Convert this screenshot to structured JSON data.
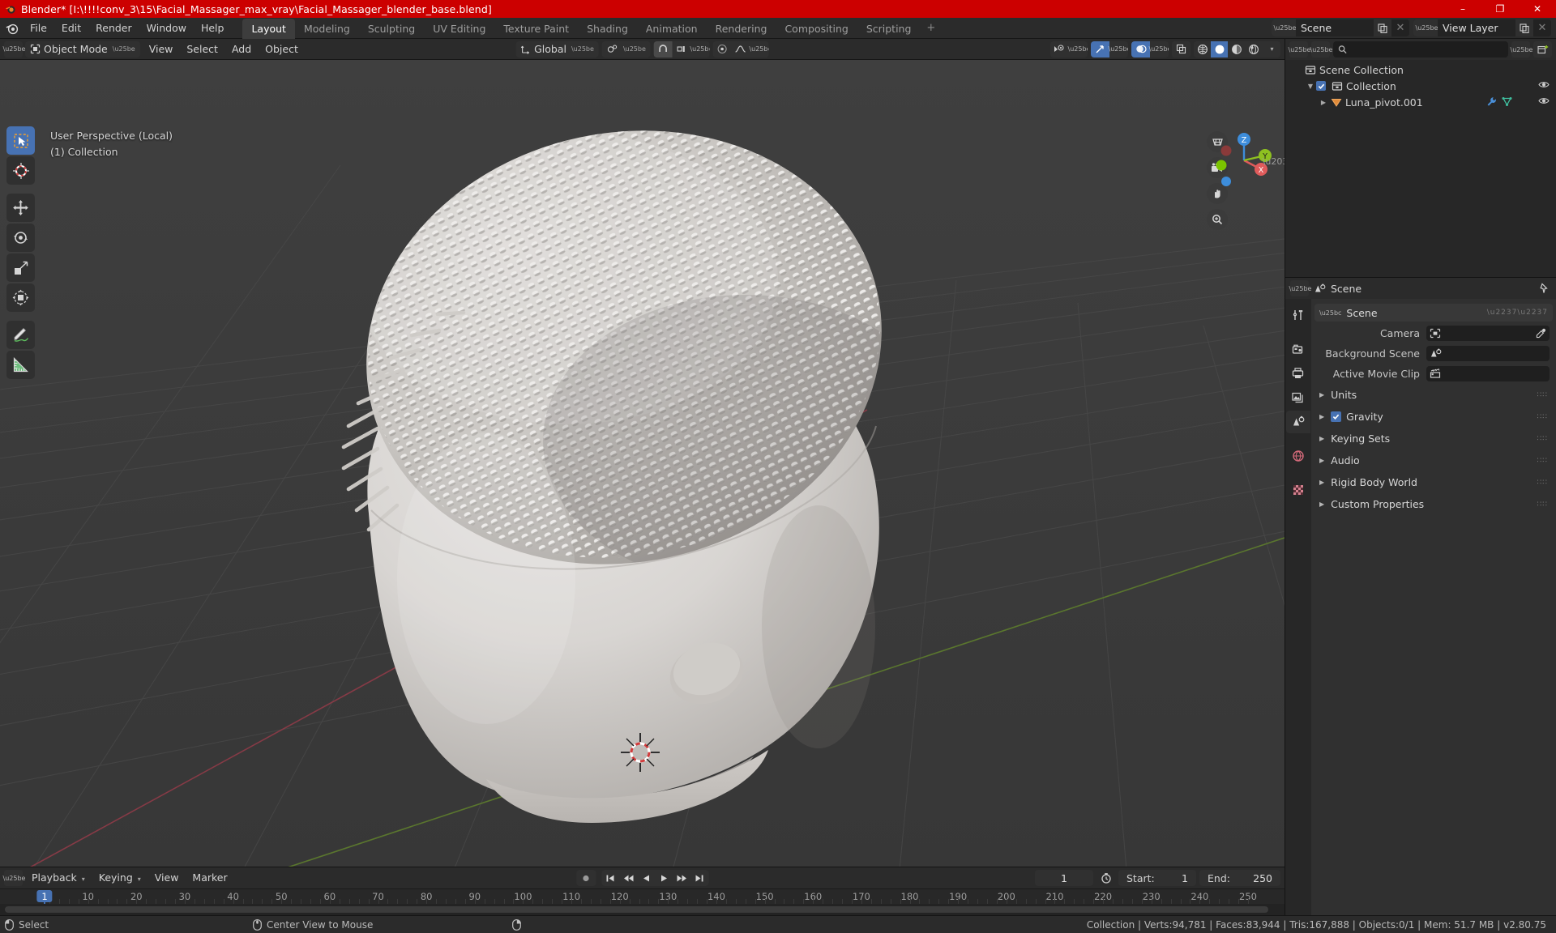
{
  "window": {
    "title": "Blender* [I:\\!!!!conv_3\\15\\Facial_Massager_max_vray\\Facial_Massager_blender_base.blend]",
    "icon": "blender-logo-icon",
    "minimize": "–",
    "maximize": "❐",
    "close": "✕"
  },
  "topbar": {
    "menus": [
      "File",
      "Edit",
      "Render",
      "Window",
      "Help"
    ],
    "workspaces": [
      {
        "label": "Layout",
        "active": true
      },
      {
        "label": "Modeling",
        "active": false
      },
      {
        "label": "Sculpting",
        "active": false
      },
      {
        "label": "UV Editing",
        "active": false
      },
      {
        "label": "Texture Paint",
        "active": false
      },
      {
        "label": "Shading",
        "active": false
      },
      {
        "label": "Animation",
        "active": false
      },
      {
        "label": "Rendering",
        "active": false
      },
      {
        "label": "Compositing",
        "active": false
      },
      {
        "label": "Scripting",
        "active": false
      }
    ],
    "add_workspace": "+",
    "scene": {
      "name": "Scene",
      "icon": "scene-icon",
      "new_label": "new-scene-icon",
      "remove_label": "✕"
    },
    "view_layer": {
      "name": "View Layer",
      "icon": "view-layer-icon",
      "new_label": "new-layer-icon",
      "remove_label": "✕"
    }
  },
  "viewport": {
    "header": {
      "editor_type": "editor-type-3dview-icon",
      "mode": "Object Mode",
      "menus": [
        "View",
        "Select",
        "Add",
        "Object"
      ],
      "transform_orientation": "Global",
      "snap_icon": "magnet-icon",
      "snap_target": "snap-increment-icon",
      "proportional_icon": "proportional-edit-icon",
      "falloff_icon": "smooth-falloff-icon",
      "pivot_icon": "pivot-point-icon",
      "visibility_icon": "object-visibility-icon",
      "gizmo_icon": "gizmo-icon",
      "overlay_icon": "overlays-icon",
      "xray_icon": "xray-icon",
      "shading_modes": [
        "wireframe",
        "solid",
        "material-preview",
        "rendered"
      ],
      "shading_active": "solid"
    },
    "overlay_text": [
      "User Perspective (Local)",
      "(1) Collection"
    ],
    "tools": [
      {
        "name": "select-box-tool",
        "active": true
      },
      {
        "name": "cursor-tool",
        "active": false
      },
      {
        "name": "move-tool",
        "active": false
      },
      {
        "name": "rotate-tool",
        "active": false
      },
      {
        "name": "scale-tool",
        "active": false
      },
      {
        "name": "transform-tool",
        "active": false
      },
      {
        "name": "annotate-tool",
        "active": false
      },
      {
        "name": "measure-tool",
        "active": false
      }
    ],
    "nav_buttons": [
      "toggle-orthographic-icon",
      "camera-view-icon",
      "move-view-icon",
      "zoom-view-icon"
    ],
    "gizmo_axes": [
      {
        "label": "Z",
        "color": "#3d8ddb"
      },
      {
        "label": "Y",
        "color": "#8ec020"
      },
      {
        "label": "X",
        "color": "#e05b5b"
      }
    ],
    "object_color": "#d5d2cf",
    "background_color": "#3b3b3b"
  },
  "timeline": {
    "editor_icon": "editor-type-timeline-icon",
    "menus": [
      "Playback",
      "Keying",
      "View",
      "Marker"
    ],
    "record_icon": "auto-keying-icon",
    "controls": [
      "jump-to-start",
      "jump-prev-keyframe",
      "play-reverse",
      "play",
      "jump-next-keyframe",
      "jump-to-end"
    ],
    "current_frame": "1",
    "timer_icon": "frame-range-icon",
    "start_label": "Start:",
    "start_value": "1",
    "end_label": "End:",
    "end_value": "250",
    "ticks": [
      "10",
      "20",
      "30",
      "40",
      "50",
      "60",
      "70",
      "80",
      "90",
      "100",
      "110",
      "120",
      "130",
      "140",
      "150",
      "160",
      "170",
      "180",
      "190",
      "200",
      "210",
      "220",
      "230",
      "240",
      "250"
    ],
    "playhead_label": "1"
  },
  "outliner": {
    "display_mode_icon": "outliner-display-mode-icon",
    "filter_id_icon": "outliner-id-type-icon",
    "search_placeholder": "",
    "search_value": "",
    "filter_icon": "filter-icon",
    "new_collection_icon": "new-collection-icon",
    "rows": [
      {
        "label": "Scene Collection",
        "icon": "collection-icon",
        "indent": 0,
        "triangle": "",
        "checkbox": false,
        "eye": false,
        "sub_icons": []
      },
      {
        "label": "Collection",
        "icon": "collection-icon",
        "indent": 1,
        "triangle": "▼",
        "checkbox": true,
        "eye": true,
        "sub_icons": []
      },
      {
        "label": "Luna_pivot.001",
        "icon": "mesh-object-icon",
        "indent": 2,
        "triangle": "▶",
        "checkbox": false,
        "eye": true,
        "sub_icons": [
          "modifier-icon",
          "mesh-data-icon"
        ]
      }
    ]
  },
  "properties": {
    "editor_icon": "editor-type-properties-icon",
    "breadcrumb_icon": "scene-icon",
    "breadcrumb": "Scene",
    "pin_icon": "pin-icon",
    "tabs": [
      {
        "name": "tool-tab",
        "active": false
      },
      {
        "name": "render-tab",
        "active": false
      },
      {
        "name": "output-tab",
        "active": false
      },
      {
        "name": "view-layer-tab",
        "active": false
      },
      {
        "name": "scene-tab",
        "active": true
      },
      {
        "name": "world-tab",
        "active": false
      },
      {
        "name": "texture-tab",
        "active": false
      }
    ],
    "panel_title": "Scene",
    "fields": [
      {
        "label": "Camera",
        "value": "",
        "icon": "camera-data-icon",
        "eyedropper": true
      },
      {
        "label": "Background Scene",
        "value": "",
        "icon": "scene-icon",
        "eyedropper": false
      },
      {
        "label": "Active Movie Clip",
        "value": "",
        "icon": "movie-clip-icon",
        "eyedropper": false
      }
    ],
    "subpanels": [
      {
        "label": "Units",
        "checkbox": false
      },
      {
        "label": "Gravity",
        "checkbox": true
      },
      {
        "label": "Keying Sets",
        "checkbox": false
      },
      {
        "label": "Audio",
        "checkbox": false
      },
      {
        "label": "Rigid Body World",
        "checkbox": false
      },
      {
        "label": "Custom Properties",
        "checkbox": false
      }
    ]
  },
  "statusbar": {
    "left_mouse_icon": "left-mouse-icon",
    "left_label": "Select",
    "middle_mouse_icon": "middle-mouse-icon",
    "middle_label": "Center View to Mouse",
    "right_mouse_icon": "right-mouse-icon",
    "right_label": "",
    "stats": "Collection | Verts:94,781 | Faces:83,944 | Tris:167,888 | Objects:0/1 | Mem: 51.7 MB | v2.80.75"
  }
}
